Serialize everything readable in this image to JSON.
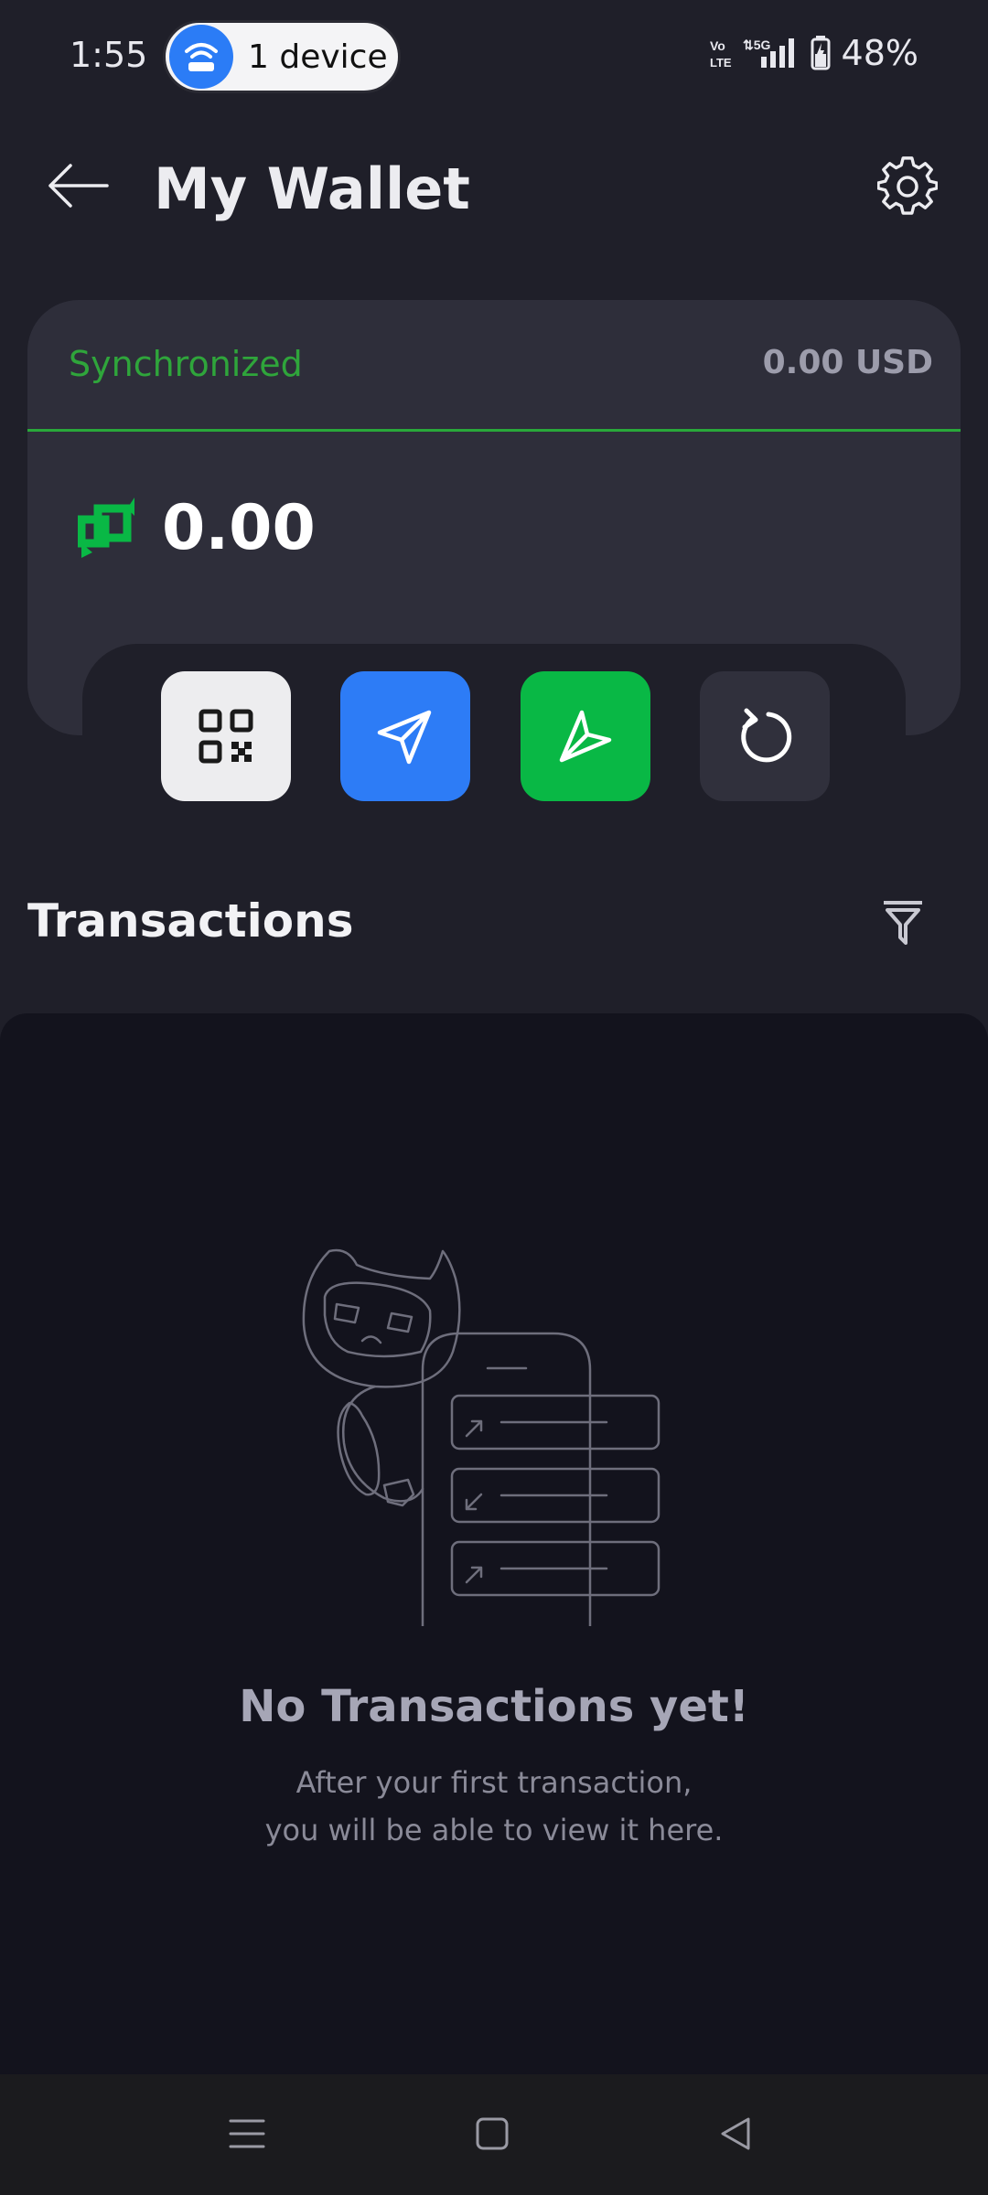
{
  "status_bar": {
    "time": "1:55",
    "hotspot_label": "1 device",
    "network_volte": "Vo LTE",
    "network_type": "5G",
    "battery": "48%"
  },
  "header": {
    "title": "My Wallet",
    "back_icon": "arrow-left-icon",
    "settings_icon": "gear-icon"
  },
  "wallet": {
    "sync_status": "Synchronized",
    "fiat_balance": "0.00 USD",
    "balance": "0.00",
    "coin_icon": "chain-link-coin-icon",
    "accent_green": "#09b845",
    "accent_blue": "#2d7cf6",
    "actions": [
      {
        "name": "receive-qr",
        "icon": "qr-code-icon"
      },
      {
        "name": "send",
        "icon": "paper-plane-icon"
      },
      {
        "name": "swap",
        "icon": "arrow-send-icon"
      },
      {
        "name": "refresh",
        "icon": "refresh-icon"
      }
    ]
  },
  "transactions": {
    "title": "Transactions",
    "filter_icon": "filter-icon",
    "empty_title": "No Transactions yet!",
    "empty_line1": "After your first transaction,",
    "empty_line2": "you will be able to view it here."
  },
  "nav": {
    "menu_icon": "menu-icon",
    "home_icon": "home-square-icon",
    "back_icon": "back-triangle-icon"
  }
}
